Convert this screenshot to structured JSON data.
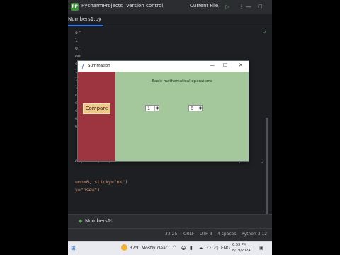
{
  "ide": {
    "logo": "PP",
    "project": "PycharmProjects",
    "vcs": "Version control",
    "run_config": "Current File",
    "file_tab": "Numbers1.py",
    "tab_close": "×",
    "code_lines": [
      {
        "text": "or",
        "color": "#bcbec4"
      },
      {
        "text": "l",
        "color": "#bcbec4"
      },
      {
        "text": "or",
        "color": "#bcbec4"
      },
      {
        "text": "on",
        "color": "#bcbec4"
      },
      {
        "text": "or",
        "color": "#bcbec4"
      },
      {
        "text": "l",
        "color": "#bcbec4"
      },
      {
        "text": "l",
        "color": "#bcbec4"
      },
      {
        "text": "l",
        "color": "#bcbec4"
      },
      {
        "text": "ol",
        "color": "#bcbec4"
      },
      {
        "text": "e",
        "color": "#bcbec4"
      },
      {
        "text": "e",
        "color": "#bcbec4"
      },
      {
        "text": "e",
        "color": "#bcbec4"
      },
      {
        "text": "e",
        "color": "#bcbec4"
      }
    ],
    "code_row1": "ol,     ,   ,                                              ,       ,                ,       \"aspare)",
    "code_row2": "umn=0, sticky=\"nk\")",
    "code_row3": "y=\"nsew\")",
    "run_tab": "Numbers1",
    "status": {
      "position": "33:25",
      "line_sep": "CRLF",
      "encoding": "UTF-8",
      "indent": "4 spaces",
      "interpreter": "Python 3.12"
    }
  },
  "dialog": {
    "title": "Summation",
    "minimize": "—",
    "maximize": "☐",
    "close": "✕",
    "compare_label": "Compare",
    "heading": "Basic mathematical operations",
    "spin1_value": "1",
    "spin2_value": "0"
  },
  "taskbar": {
    "temperature": "37°C",
    "weather": "Mostly clear",
    "language": "ENG",
    "time": "6:53 PM",
    "date": "8/19/2024"
  }
}
